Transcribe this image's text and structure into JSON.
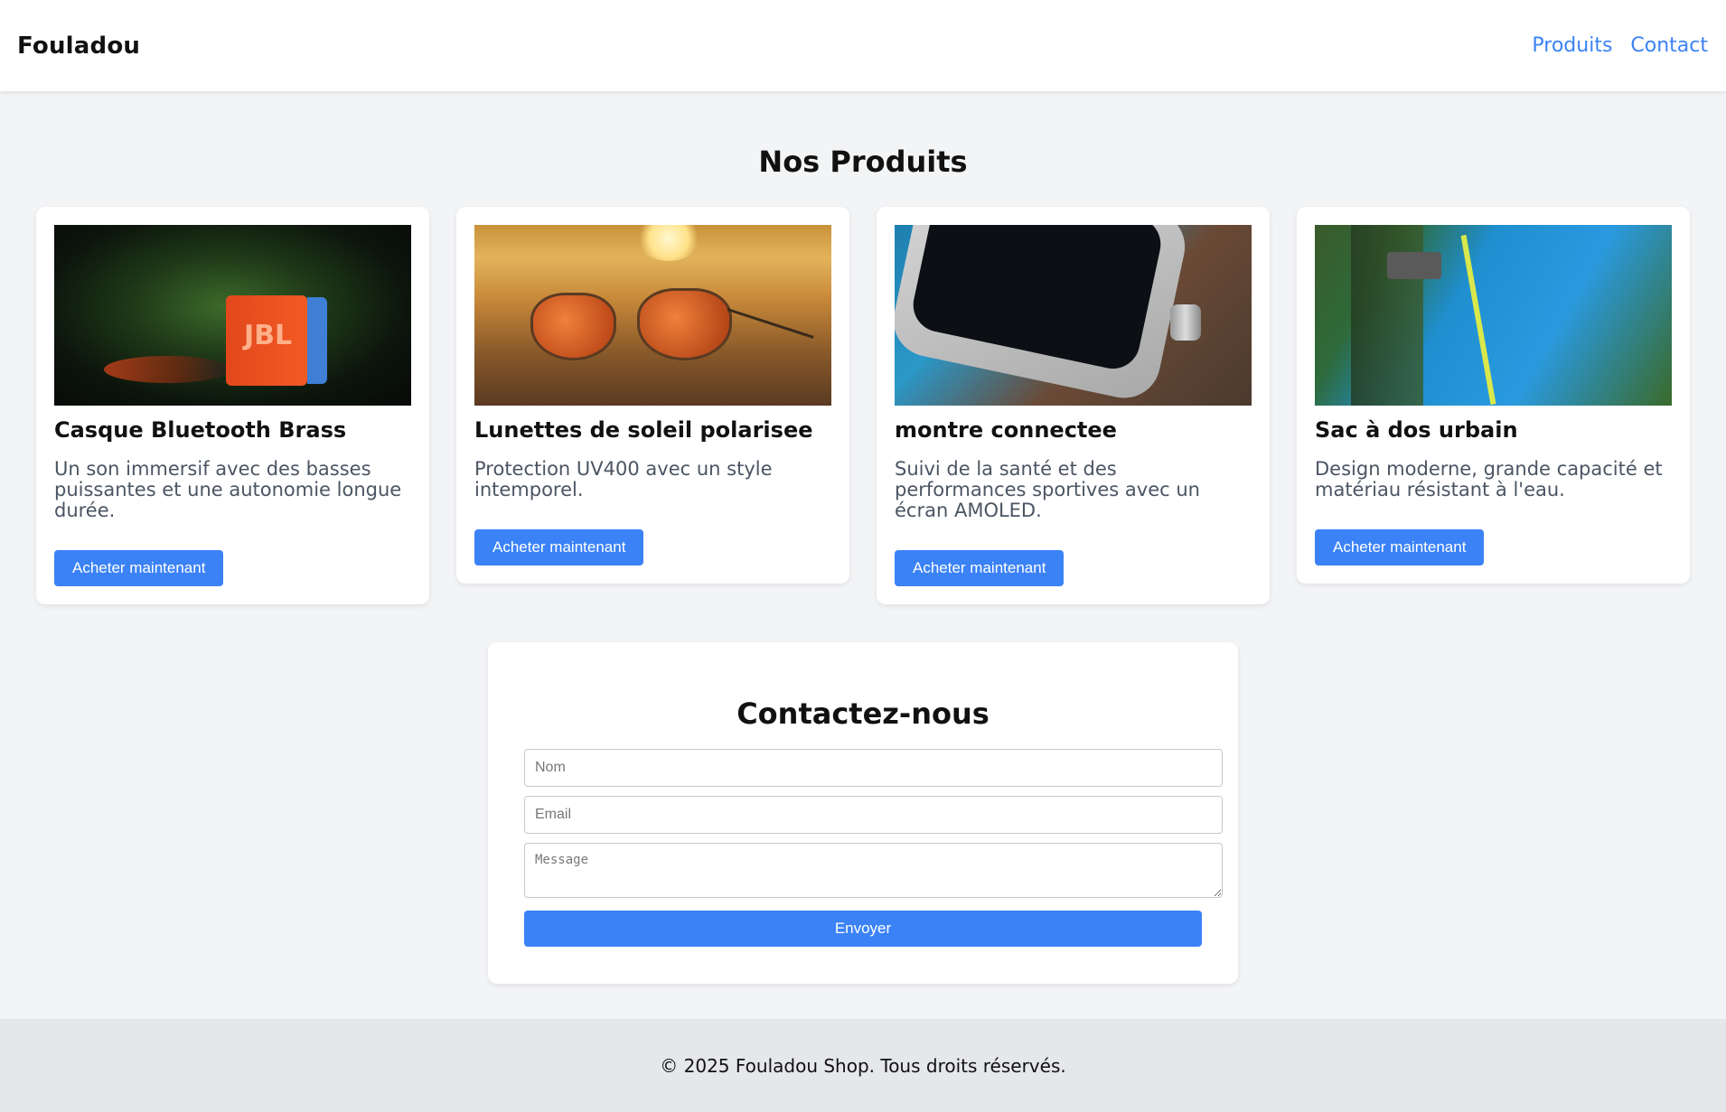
{
  "header": {
    "logo": "Fouladou",
    "nav": [
      {
        "label": "Produits"
      },
      {
        "label": "Contact"
      }
    ]
  },
  "products_section": {
    "title": "Nos Produits",
    "items": [
      {
        "image_icon": "bluetooth-speaker-photo",
        "image_brand_text": "JBL",
        "name": "Casque Bluetooth Brass",
        "description": "Un son immersif avec des basses puissantes et une autonomie longue durée.",
        "button_label": "Acheter maintenant"
      },
      {
        "image_icon": "sunglasses-photo",
        "name": "Lunettes de soleil polarisee",
        "description": "Protection UV400 avec un style intemporel.",
        "button_label": "Acheter maintenant"
      },
      {
        "image_icon": "smartwatch-photo",
        "name": "montre connectee",
        "description": "Suivi de la santé et des performances sportives avec un écran AMOLED.",
        "button_label": "Acheter maintenant"
      },
      {
        "image_icon": "backpack-photo",
        "name": "Sac à dos urbain",
        "description": "Design moderne, grande capacité et matériau résistant à l'eau.",
        "button_label": "Acheter maintenant"
      }
    ]
  },
  "contact": {
    "title": "Contactez-nous",
    "name_placeholder": "Nom",
    "email_placeholder": "Email",
    "message_placeholder": "Message",
    "submit_label": "Envoyer"
  },
  "footer": {
    "text": "© 2025 Fouladou Shop. Tous droits réservés."
  },
  "colors": {
    "accent": "#3b82f6",
    "page_background": "#f3f4f6",
    "footer_background": "#e5e7eb"
  }
}
